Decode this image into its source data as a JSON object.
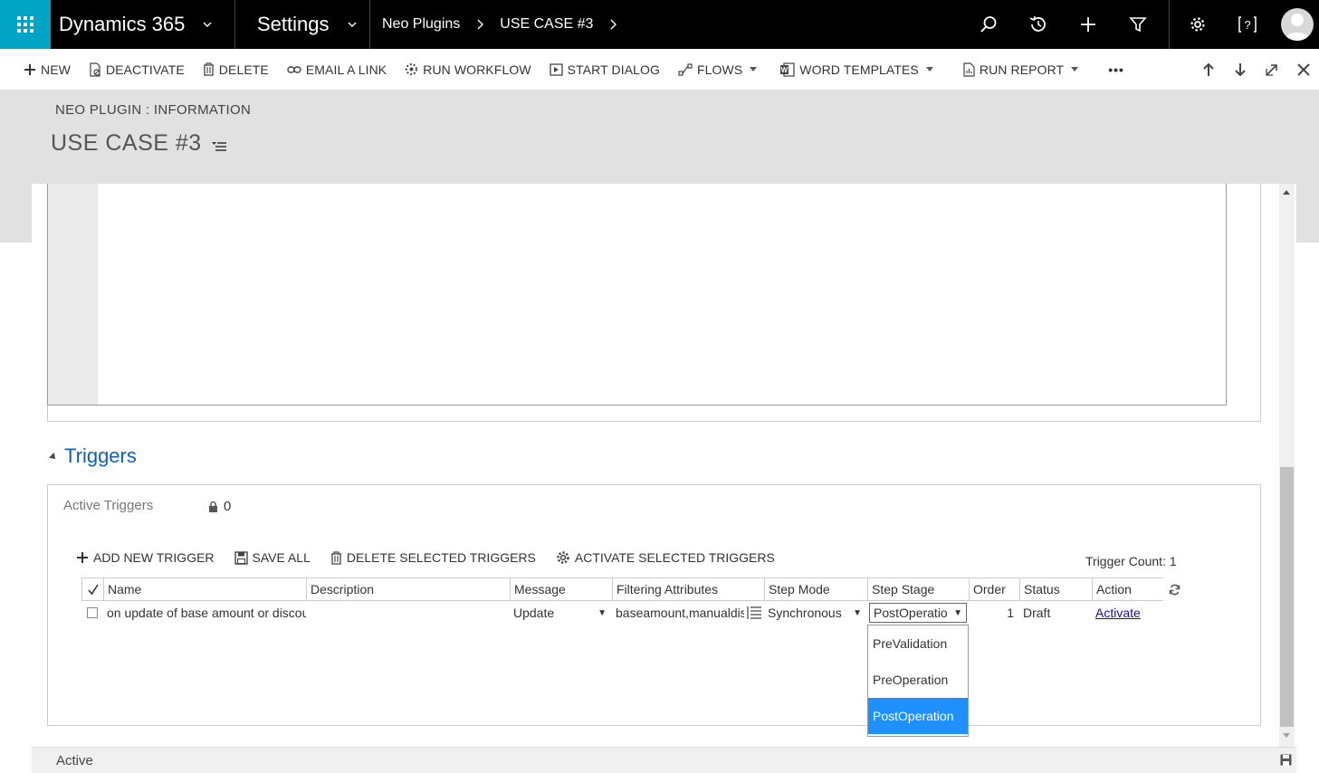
{
  "nav": {
    "app_name": "Dynamics 365",
    "area": "Settings",
    "breadcrumb": [
      "Neo Plugins",
      "USE CASE #3"
    ]
  },
  "commands": {
    "new": "NEW",
    "deactivate": "DEACTIVATE",
    "delete": "DELETE",
    "email_link": "EMAIL A LINK",
    "run_workflow": "RUN WORKFLOW",
    "start_dialog": "START DIALOG",
    "flows": "FLOWS",
    "word_templates": "WORD TEMPLATES",
    "run_report": "RUN REPORT",
    "more": "•••"
  },
  "header": {
    "entity": "NEO PLUGIN : INFORMATION",
    "title": "USE CASE #3"
  },
  "triggers": {
    "section_title": "Triggers",
    "active_label": "Active Triggers",
    "active_count": "0",
    "toolbar": {
      "add": "ADD NEW TRIGGER",
      "save_all": "SAVE ALL",
      "delete_selected": "DELETE SELECTED TRIGGERS",
      "activate_selected": "ACTIVATE SELECTED TRIGGERS"
    },
    "trigger_count": "Trigger Count: 1",
    "columns": [
      "Name",
      "Description",
      "Message",
      "Filtering Attributes",
      "Step Mode",
      "Step Stage",
      "Order",
      "Status",
      "Action"
    ],
    "rows": [
      {
        "name": "on update of base amount or discount",
        "description": "",
        "message": "Update",
        "filtering": "baseamount,manualdiscount",
        "mode": "Synchronous",
        "stage": "PostOperation",
        "order": "1",
        "status": "Draft",
        "action": "Activate"
      }
    ],
    "stage_options": [
      "PreValidation",
      "PreOperation",
      "PostOperation"
    ],
    "stage_selected": "PostOperation"
  },
  "footer": {
    "status": "Active"
  },
  "colors": {
    "waffle": "#00a4c4",
    "link": "#1160b7",
    "selected": "#1e90ff"
  }
}
